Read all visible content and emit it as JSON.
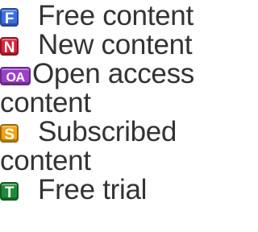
{
  "legend": {
    "items": [
      {
        "badge": "F",
        "label": "Free content",
        "color": "#3b6fe0",
        "icon": "free-content-icon"
      },
      {
        "badge": "N",
        "label": "New content",
        "color": "#d9223a",
        "icon": "new-content-icon"
      },
      {
        "badge": "OA",
        "label": "Open access content",
        "color": "#9b3fc9",
        "icon": "open-access-icon"
      },
      {
        "badge": "S",
        "label": "Subscribed content",
        "color": "#f2a312",
        "icon": "subscribed-content-icon"
      },
      {
        "badge": "T",
        "label": "Free trial",
        "color": "#1f8a3a",
        "icon": "free-trial-icon"
      }
    ]
  }
}
